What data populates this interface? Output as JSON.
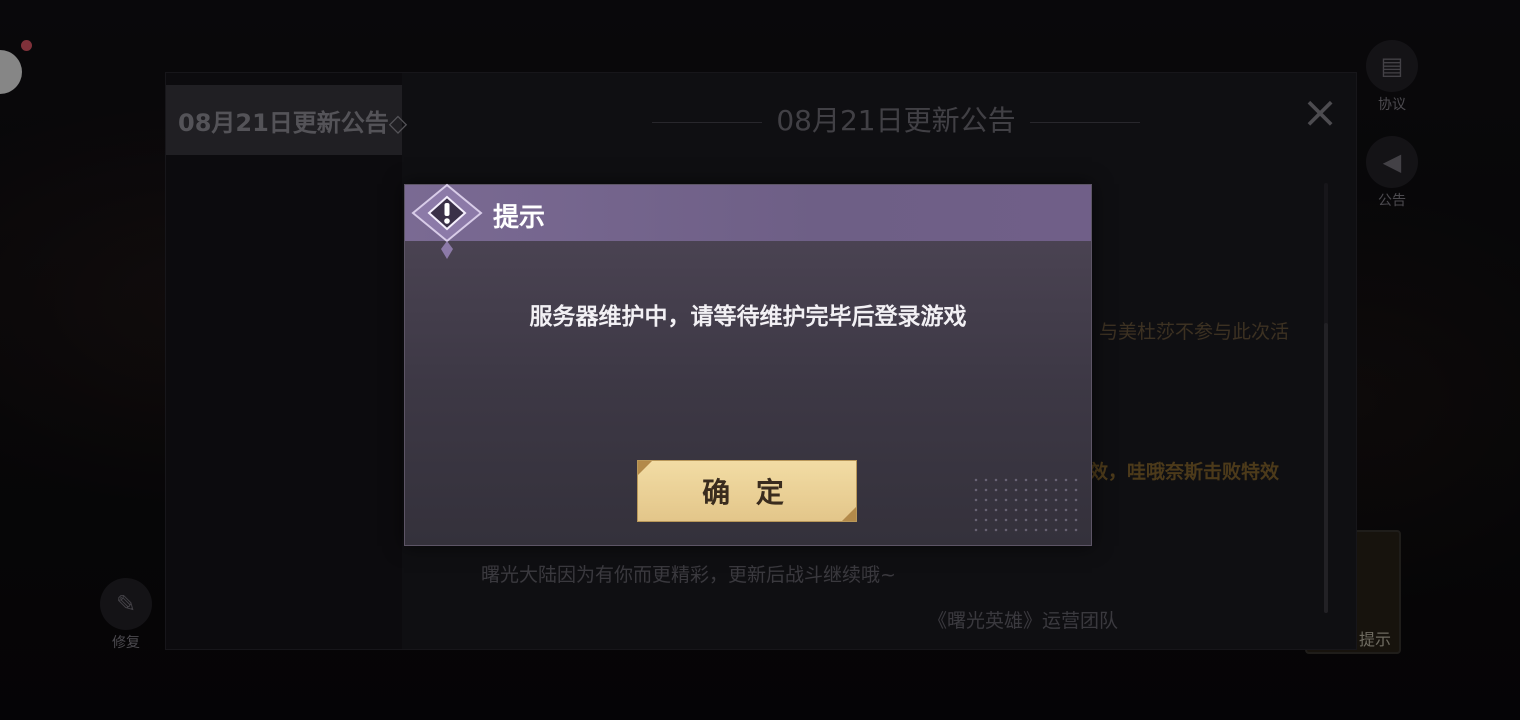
{
  "background": {
    "side_buttons": [
      {
        "label": "协议",
        "icon": "document-icon"
      },
      {
        "label": "公告",
        "icon": "megaphone-icon"
      },
      {
        "label": "修复",
        "icon": "wrench-icon"
      }
    ],
    "hint_button_label": "提示"
  },
  "announcement": {
    "sidebar_tab": "08月21日更新公告◇",
    "title": "08月21日更新公告",
    "close_icon": "close-icon",
    "partial_lines": [
      {
        "text": "与美杜莎不参与此次活",
        "color": "#6e5a3e"
      },
      {
        "text": "效，哇哦奈斯击败特效",
        "color": "#8a6a30"
      },
      {
        "text": "曙光大陆因为有你而更精彩，更新后战斗继续哦~",
        "color": "#6a6872"
      },
      {
        "text": "《曙光英雄》运营团队",
        "color": "#6a6872"
      }
    ]
  },
  "dialog": {
    "title": "提示",
    "icon": "warning-icon",
    "message": "服务器维护中，请等待维护完毕后登录游戏",
    "confirm_label": "确 定"
  },
  "colors": {
    "dialog_header": "#7a6a93",
    "confirm_button": "#e9d198",
    "alert_dot": "#e85a6a"
  }
}
